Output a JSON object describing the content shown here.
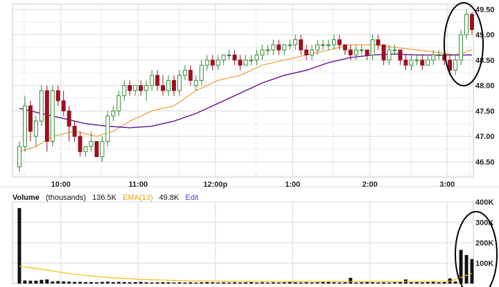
{
  "legend": {
    "volume_label": "Volume",
    "units": "(thousands)",
    "volume_value": "136.5K",
    "ema_label": "EMA(13)",
    "ema_value": "49.8K",
    "edit_label": "Edit"
  },
  "colors": {
    "up": "#2e8b2e",
    "down": "#9b1020",
    "ema_fast": "#f0a040",
    "ema_slow": "#6a1f9a",
    "volume_ema": "#f0c000",
    "grid": "#d8d8d8",
    "annotation": "#000000"
  },
  "chart_data": [
    {
      "type": "candlestick",
      "title": "",
      "x_ticks": [
        "10:00",
        "11:00",
        "12:00p",
        "1:00",
        "2:00",
        "3:00"
      ],
      "y_ticks": [
        "46.50",
        "47.00",
        "47.50",
        "48.00",
        "48.50",
        "49.00",
        "49.50"
      ],
      "ylim": [
        46.2,
        49.6
      ],
      "grid": true,
      "y_axis_side": "right",
      "candles_ohlc": [
        [
          46.4,
          46.9,
          46.3,
          46.8
        ],
        [
          46.8,
          47.8,
          46.7,
          47.6
        ],
        [
          47.6,
          47.7,
          46.9,
          47.1
        ],
        [
          47.0,
          47.4,
          46.8,
          47.3
        ],
        [
          47.3,
          48.0,
          47.2,
          47.9
        ],
        [
          47.9,
          48.0,
          46.7,
          46.9
        ],
        [
          46.9,
          48.0,
          46.8,
          47.9
        ],
        [
          47.9,
          48.0,
          47.6,
          47.7
        ],
        [
          47.7,
          47.9,
          47.4,
          47.5
        ],
        [
          47.5,
          47.6,
          46.9,
          47.2
        ],
        [
          47.2,
          47.3,
          46.9,
          47.0
        ],
        [
          47.0,
          47.1,
          46.6,
          46.7
        ],
        [
          46.7,
          46.8,
          46.6,
          46.8
        ],
        [
          46.8,
          47.1,
          46.7,
          46.9
        ],
        [
          46.9,
          46.9,
          46.6,
          46.6
        ],
        [
          46.6,
          47.0,
          46.5,
          46.9
        ],
        [
          46.9,
          47.5,
          46.8,
          47.4
        ],
        [
          47.4,
          47.6,
          47.3,
          47.5
        ],
        [
          47.5,
          47.9,
          47.4,
          47.8
        ],
        [
          47.8,
          48.1,
          47.7,
          48.0
        ],
        [
          48.0,
          48.1,
          47.8,
          47.9
        ],
        [
          47.9,
          48.0,
          47.8,
          48.0
        ],
        [
          48.0,
          48.1,
          47.8,
          47.9
        ],
        [
          47.9,
          48.1,
          47.7,
          48.0
        ],
        [
          48.0,
          48.3,
          47.9,
          48.2
        ],
        [
          48.2,
          48.3,
          47.9,
          48.0
        ],
        [
          48.0,
          48.2,
          47.8,
          47.9
        ],
        [
          47.9,
          48.2,
          47.8,
          48.1
        ],
        [
          48.1,
          48.2,
          47.8,
          47.9
        ],
        [
          47.9,
          48.3,
          47.8,
          48.2
        ],
        [
          48.2,
          48.4,
          48.1,
          48.3
        ],
        [
          48.3,
          48.4,
          48.0,
          48.1
        ],
        [
          48.0,
          48.2,
          47.9,
          48.1
        ],
        [
          48.1,
          48.5,
          48.0,
          48.4
        ],
        [
          48.4,
          48.6,
          48.3,
          48.5
        ],
        [
          48.5,
          48.6,
          48.3,
          48.4
        ],
        [
          48.4,
          48.6,
          48.3,
          48.5
        ],
        [
          48.5,
          48.6,
          48.4,
          48.6
        ],
        [
          48.6,
          48.7,
          48.5,
          48.6
        ],
        [
          48.6,
          48.7,
          48.4,
          48.5
        ],
        [
          48.5,
          48.6,
          48.3,
          48.4
        ],
        [
          48.4,
          48.6,
          48.4,
          48.5
        ],
        [
          48.5,
          48.6,
          48.4,
          48.5
        ],
        [
          48.5,
          48.7,
          48.4,
          48.6
        ],
        [
          48.6,
          48.8,
          48.5,
          48.7
        ],
        [
          48.7,
          48.8,
          48.6,
          48.7
        ],
        [
          48.7,
          48.9,
          48.6,
          48.8
        ],
        [
          48.8,
          48.9,
          48.6,
          48.7
        ],
        [
          48.7,
          48.8,
          48.6,
          48.8
        ],
        [
          48.8,
          48.9,
          48.7,
          48.8
        ],
        [
          48.8,
          49.0,
          48.7,
          48.9
        ],
        [
          48.9,
          49.0,
          48.6,
          48.7
        ],
        [
          48.7,
          48.8,
          48.5,
          48.6
        ],
        [
          48.6,
          48.8,
          48.5,
          48.7
        ],
        [
          48.7,
          48.9,
          48.6,
          48.8
        ],
        [
          48.8,
          48.9,
          48.7,
          48.8
        ],
        [
          48.8,
          48.9,
          48.7,
          48.8
        ],
        [
          48.8,
          49.0,
          48.7,
          48.9
        ],
        [
          48.9,
          49.0,
          48.7,
          48.8
        ],
        [
          48.8,
          48.8,
          48.6,
          48.7
        ],
        [
          48.7,
          48.8,
          48.5,
          48.6
        ],
        [
          48.6,
          48.8,
          48.5,
          48.7
        ],
        [
          48.7,
          48.8,
          48.6,
          48.7
        ],
        [
          48.7,
          48.7,
          48.5,
          48.6
        ],
        [
          48.6,
          49.0,
          48.5,
          48.9
        ],
        [
          48.9,
          49.0,
          48.7,
          48.8
        ],
        [
          48.8,
          48.8,
          48.4,
          48.5
        ],
        [
          48.5,
          48.8,
          48.4,
          48.7
        ],
        [
          48.7,
          48.8,
          48.6,
          48.7
        ],
        [
          48.7,
          48.7,
          48.4,
          48.5
        ],
        [
          48.5,
          48.6,
          48.3,
          48.4
        ],
        [
          48.4,
          48.6,
          48.3,
          48.5
        ],
        [
          48.5,
          48.6,
          48.4,
          48.5
        ],
        [
          48.5,
          48.6,
          48.3,
          48.4
        ],
        [
          48.4,
          48.6,
          48.4,
          48.5
        ],
        [
          48.5,
          48.7,
          48.4,
          48.6
        ],
        [
          48.6,
          48.7,
          48.5,
          48.6
        ],
        [
          48.6,
          48.7,
          48.4,
          48.5
        ],
        [
          48.5,
          48.6,
          48.2,
          48.3
        ],
        [
          48.3,
          48.6,
          48.2,
          48.5
        ],
        [
          48.5,
          49.1,
          48.4,
          49.0
        ],
        [
          49.0,
          49.5,
          48.9,
          49.4
        ],
        [
          49.4,
          49.45,
          49.0,
          49.1
        ]
      ],
      "ema_fast": [
        [
          0,
          46.7
        ],
        [
          3,
          46.8
        ],
        [
          6,
          47.0
        ],
        [
          10,
          47.1
        ],
        [
          14,
          47.0
        ],
        [
          17,
          47.1
        ],
        [
          20,
          47.3
        ],
        [
          24,
          47.5
        ],
        [
          28,
          47.6
        ],
        [
          32,
          47.9
        ],
        [
          36,
          48.1
        ],
        [
          40,
          48.2
        ],
        [
          44,
          48.4
        ],
        [
          48,
          48.5
        ],
        [
          52,
          48.6
        ],
        [
          56,
          48.7
        ],
        [
          60,
          48.8
        ],
        [
          64,
          48.8
        ],
        [
          68,
          48.75
        ],
        [
          72,
          48.7
        ],
        [
          76,
          48.65
        ],
        [
          79,
          48.6
        ],
        [
          82,
          48.7
        ]
      ],
      "ema_slow": [
        [
          0,
          47.55
        ],
        [
          4,
          47.45
        ],
        [
          8,
          47.35
        ],
        [
          12,
          47.25
        ],
        [
          16,
          47.2
        ],
        [
          20,
          47.17
        ],
        [
          24,
          47.2
        ],
        [
          28,
          47.3
        ],
        [
          32,
          47.45
        ],
        [
          36,
          47.65
        ],
        [
          40,
          47.85
        ],
        [
          44,
          48.05
        ],
        [
          48,
          48.2
        ],
        [
          52,
          48.3
        ],
        [
          56,
          48.45
        ],
        [
          60,
          48.55
        ],
        [
          64,
          48.6
        ],
        [
          68,
          48.62
        ],
        [
          72,
          48.6
        ],
        [
          76,
          48.6
        ],
        [
          79,
          48.6
        ],
        [
          82,
          48.6
        ]
      ]
    },
    {
      "type": "bar",
      "title": "Volume (thousands)",
      "y_ticks": [
        "100K",
        "200K",
        "300K",
        "400K"
      ],
      "ylim": [
        0,
        400
      ],
      "volume": [
        370,
        15,
        14,
        14,
        18,
        20,
        10,
        12,
        10,
        9,
        8,
        8,
        7,
        7,
        6,
        8,
        9,
        7,
        8,
        7,
        6,
        7,
        8,
        6,
        5,
        6,
        7,
        6,
        5,
        6,
        5,
        6,
        5,
        6,
        7,
        6,
        5,
        6,
        5,
        6,
        5,
        6,
        7,
        5,
        6,
        5,
        6,
        5,
        6,
        7,
        6,
        5,
        6,
        5,
        6,
        7,
        8,
        6,
        5,
        6,
        28,
        5,
        6,
        7,
        6,
        5,
        6,
        5,
        6,
        7,
        20,
        6,
        7,
        6,
        7,
        8,
        6,
        7,
        25,
        10,
        165,
        140,
        120
      ],
      "volume_ema": [
        [
          0,
          85
        ],
        [
          4,
          70
        ],
        [
          10,
          45
        ],
        [
          16,
          30
        ],
        [
          22,
          20
        ],
        [
          30,
          14
        ],
        [
          40,
          11
        ],
        [
          50,
          10
        ],
        [
          60,
          10
        ],
        [
          70,
          10
        ],
        [
          78,
          11
        ],
        [
          82,
          50
        ]
      ]
    }
  ]
}
